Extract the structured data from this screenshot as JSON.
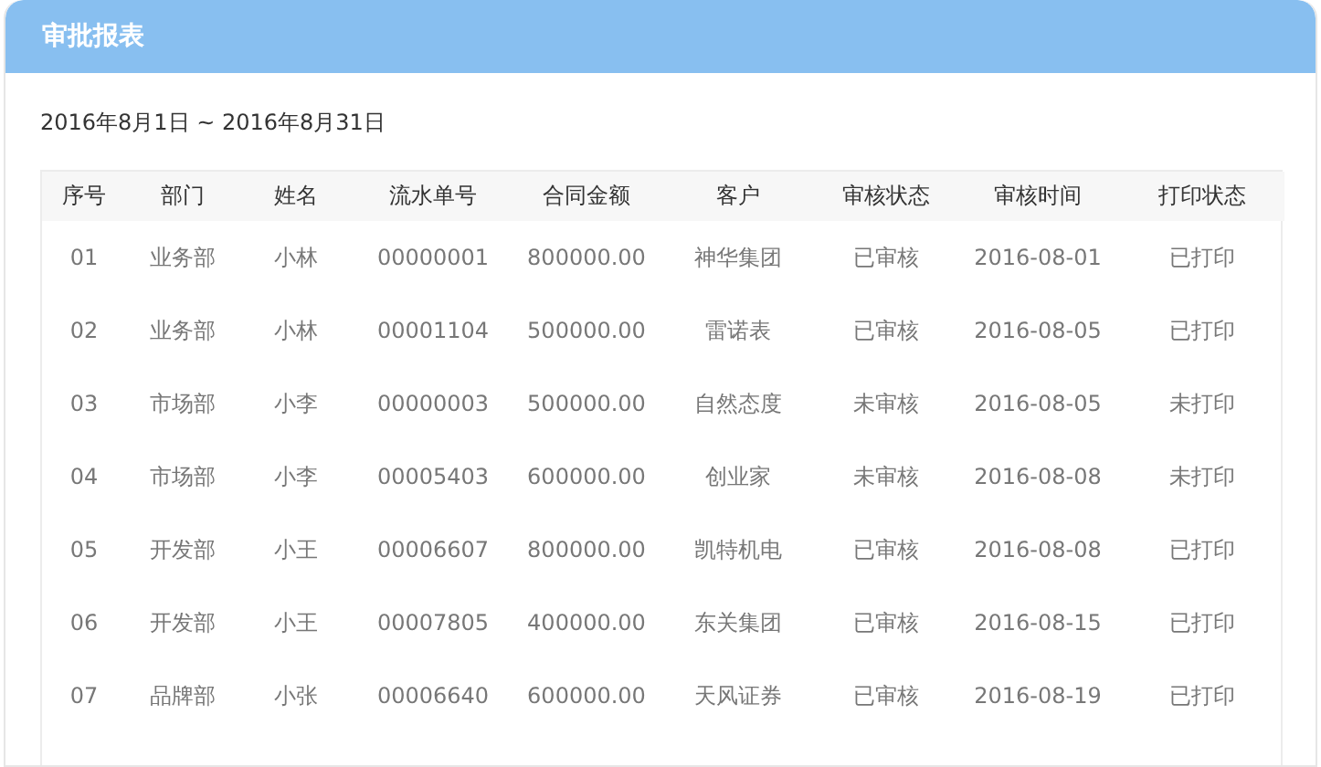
{
  "panel": {
    "title": "审批报表",
    "date_range": "2016年8月1日 ~ 2016年8月31日"
  },
  "table": {
    "columns": [
      "序号",
      "部门",
      "姓名",
      "流水单号",
      "合同金额",
      "客户",
      "审核状态",
      "审核时间",
      "打印状态"
    ],
    "rows": [
      [
        "01",
        "业务部",
        "小林",
        "00000001",
        "800000.00",
        "神华集团",
        "已审核",
        "2016-08-01",
        "已打印"
      ],
      [
        "02",
        "业务部",
        "小林",
        "00001104",
        "500000.00",
        "雷诺表",
        "已审核",
        "2016-08-05",
        "已打印"
      ],
      [
        "03",
        "市场部",
        "小李",
        "00000003",
        "500000.00",
        "自然态度",
        "未审核",
        "2016-08-05",
        "未打印"
      ],
      [
        "04",
        "市场部",
        "小李",
        "00005403",
        "600000.00",
        "创业家",
        "未审核",
        "2016-08-08",
        "未打印"
      ],
      [
        "05",
        "开发部",
        "小王",
        "00006607",
        "800000.00",
        "凯特机电",
        "已审核",
        "2016-08-08",
        "已打印"
      ],
      [
        "06",
        "开发部",
        "小王",
        "00007805",
        "400000.00",
        "东关集团",
        "已审核",
        "2016-08-15",
        "已打印"
      ],
      [
        "07",
        "品牌部",
        "小张",
        "00006640",
        "600000.00",
        "天风证券",
        "已审核",
        "2016-08-19",
        "已打印"
      ]
    ]
  }
}
